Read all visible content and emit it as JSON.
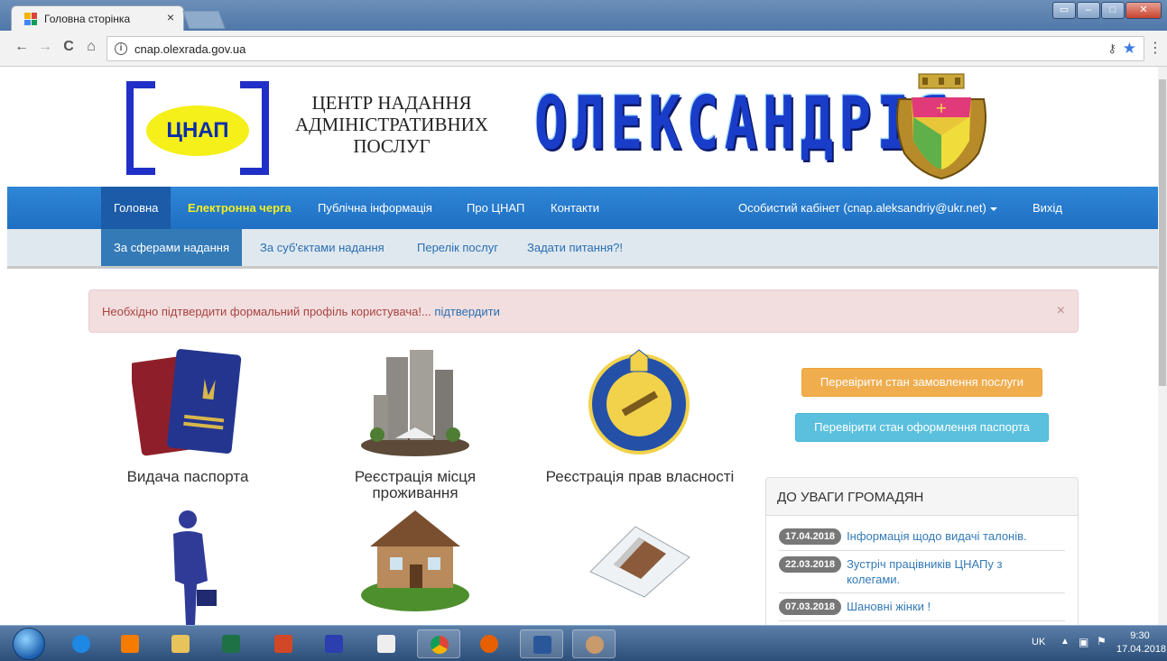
{
  "browser": {
    "tab_title": "Головна сторінка",
    "tab_close": "×",
    "url": "cnap.olexrada.gov.ua",
    "back": "←",
    "forward": "→",
    "reload": "C",
    "home": "⌂",
    "key_icon": "key-icon",
    "star_icon": "star-icon",
    "menu": "⋮"
  },
  "header": {
    "logo_text": "ЦНАП",
    "org_name_lines": [
      "ЦЕНТР НАДАННЯ",
      "АДМІНІСТРАТИВНИХ",
      "ПОСЛУГ"
    ],
    "city_title": "ОЛЕКСАНДРІЯ"
  },
  "nav": {
    "items": [
      {
        "label": "Головна"
      },
      {
        "label": "Електронна черга"
      },
      {
        "label": "Публічна інформація"
      },
      {
        "label": "Про ЦНАП"
      },
      {
        "label": "Контакти"
      }
    ],
    "cabinet": "Особистий кабінет (cnap.aleksandriy@ukr.net)",
    "logout": "Вихід"
  },
  "subnav": {
    "items": [
      {
        "label": "За сферами надання"
      },
      {
        "label": "За суб'єктами надання"
      },
      {
        "label": "Перелік послуг"
      },
      {
        "label": "Задати питання?!"
      }
    ]
  },
  "alert": {
    "text": "Необхідно підтвердити формальний профіль користувача!... ",
    "link": "підтвердити",
    "close": "×"
  },
  "services": [
    {
      "label": "Видача паспорта"
    },
    {
      "label": "Реєстрація місця проживання"
    },
    {
      "label": "Реєстрація прав власності"
    }
  ],
  "buttons": {
    "check_order": "Перевірити стан замовлення послуги",
    "check_passport": "Перевірити стан оформлення паспорта"
  },
  "news": {
    "title": "ДО УВАГИ ГРОМАДЯН",
    "items": [
      {
        "date": "17.04.2018",
        "text": "Інформація щодо видачі талонів."
      },
      {
        "date": "22.03.2018",
        "text": "Зустріч працівників ЦНАПу з колегами."
      },
      {
        "date": "07.03.2018",
        "text": "Шановні жінки !"
      }
    ]
  },
  "taskbar": {
    "lang": "UK",
    "time": "9:30",
    "date": "17.04.2018"
  },
  "colors": {
    "nav_blue": "#1f6fc2",
    "highlight_yellow": "#f2ef23",
    "orange_button": "#f0ad4e",
    "cyan_button": "#5bc0de",
    "alert_bg": "#f2dede"
  }
}
